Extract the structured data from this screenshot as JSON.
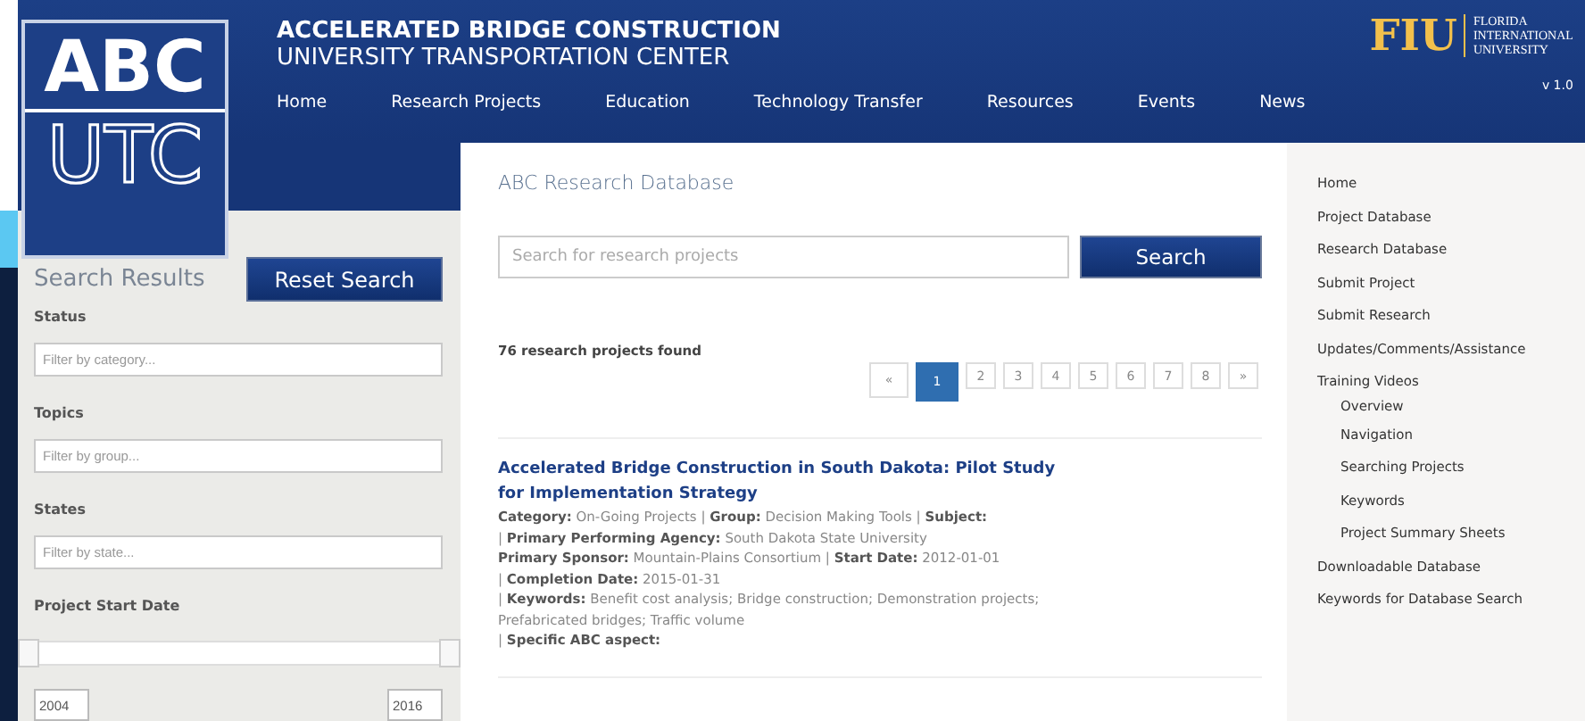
{
  "header": {
    "logo": {
      "top": "ABC",
      "bottom": "UTC"
    },
    "title": "ACCELERATED BRIDGE CONSTRUCTION",
    "subtitle": "UNIVERSITY TRANSPORTATION CENTER",
    "partner": {
      "mark": "FIU",
      "name": [
        "FLORIDA",
        "INTERNATIONAL",
        "UNIVERSITY"
      ]
    },
    "version": "v 1.0",
    "nav": [
      {
        "label": "Home"
      },
      {
        "label": "Research Projects"
      },
      {
        "label": "Education"
      },
      {
        "label": "Technology Transfer"
      },
      {
        "label": "Resources"
      },
      {
        "label": "Events"
      },
      {
        "label": "News"
      }
    ]
  },
  "filters": {
    "title": "Search Results",
    "reset_button": "Reset Search",
    "groups": [
      {
        "label": "Status",
        "placeholder": "Filter by category..."
      },
      {
        "label": "Topics",
        "placeholder": "Filter by group..."
      },
      {
        "label": "States",
        "placeholder": "Filter by state..."
      }
    ],
    "date_range": {
      "label": "Project Start Date",
      "thumbs": [
        {
          "level": 0
        },
        {
          "level": 1
        }
      ],
      "from": "2004",
      "to": "2016"
    }
  },
  "main": {
    "title": "ABC Research Database",
    "search": {
      "placeholder": "Search for research projects",
      "button": "Search"
    },
    "count": "76 research projects found",
    "pagination": [
      {
        "label": "«",
        "selected": false
      },
      {
        "label": "1",
        "selected": true
      },
      {
        "label": "2",
        "selected": false
      },
      {
        "label": "3",
        "selected": false
      },
      {
        "label": "4",
        "selected": false
      },
      {
        "label": "5",
        "selected": false
      },
      {
        "label": "6",
        "selected": false
      },
      {
        "label": "7",
        "selected": false
      },
      {
        "label": "8",
        "selected": false
      },
      {
        "label": "»",
        "selected": false
      }
    ],
    "results": [
      {
        "title": "Accelerated Bridge Construction in South Dakota: Pilot Study for Implementation Strategy",
        "lines": [
          "**Category:** On-Going Projects | **Group:** Decision Making Tools | **Subject:**",
          "| **Primary Performing Agency:** South Dakota State University",
          "**Primary Sponsor:** Mountain-Plains Consortium | **Start Date:** 2012-01-01",
          "| **Completion Date:** 2015-01-31",
          "| **Keywords:** Benefit cost analysis; Bridge construction; Demonstration projects; Prefabricated bridges; Traffic volume",
          "| **Specific ABC aspect:**"
        ]
      }
    ]
  },
  "sidebar": {
    "items": [
      {
        "label": "Home"
      },
      {
        "label": "Project Database"
      },
      {
        "label": "Research Database"
      },
      {
        "label": "Submit Project"
      },
      {
        "label": "Submit Research"
      },
      {
        "label": "Updates/Comments/Assistance"
      },
      {
        "label": "Training Videos",
        "children": [
          {
            "label": "Overview"
          },
          {
            "label": "Navigation"
          },
          {
            "label": "Searching Projects"
          },
          {
            "label": "Keywords"
          },
          {
            "label": "Project Summary Sheets"
          }
        ]
      },
      {
        "label": "Downloadable Database"
      },
      {
        "label": "Keywords for Database Search"
      }
    ]
  }
}
